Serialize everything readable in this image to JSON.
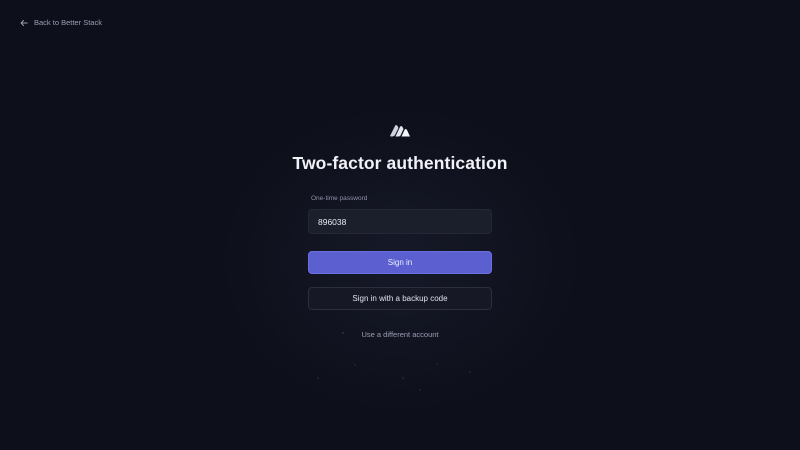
{
  "nav": {
    "back_label": "Back to Better Stack"
  },
  "form": {
    "title": "Two-factor authentication",
    "otp_label": "One-time password",
    "otp_value": "896038",
    "sign_in_label": "Sign in",
    "backup_code_label": "Sign in with a backup code",
    "different_account_label": "Use a different account"
  },
  "colors": {
    "background": "#0d0f1a",
    "primary": "#5b5fd0",
    "input_bg": "#1b1e2b"
  },
  "icons": {
    "back": "arrow-left-icon",
    "logo": "better-stack-logo"
  }
}
